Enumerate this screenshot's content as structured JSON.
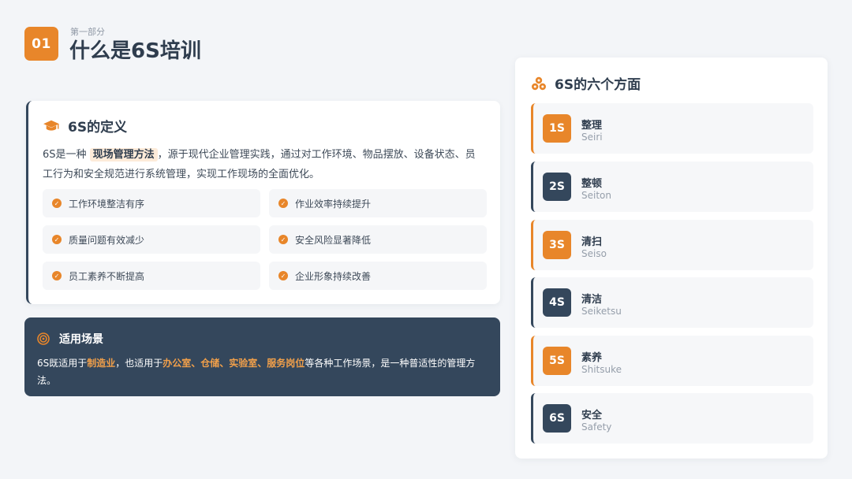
{
  "header": {
    "number": "01",
    "subtitle": "第一部分",
    "title": "什么是6S培训"
  },
  "definition": {
    "title": "6S的定义",
    "text_before": "6S是一种 ",
    "highlight": "现场管理方法",
    "text_after": "，源于现代企业管理实践，通过对工作环境、物品摆放、设备状态、员工行为和安全规范进行系统管理，实现工作现场的全面优化。",
    "features": [
      "工作环境整洁有序",
      "作业效率持续提升",
      "质量问题有效减少",
      "安全风险显著降低",
      "员工素养不断提高",
      "企业形象持续改善"
    ]
  },
  "scenario": {
    "title": "适用场景",
    "text_1": "6S既适用于",
    "h1": "制造业",
    "text_2": "，也适用于",
    "h2": "办公室、仓储、实验室、服务岗位",
    "text_3": "等各种工作场景，是一种普适性的管理方法。"
  },
  "aspects": {
    "title": "6S的六个方面",
    "items": [
      {
        "code": "1S",
        "zh": "整理",
        "en": "Seiri"
      },
      {
        "code": "2S",
        "zh": "整顿",
        "en": "Seiton"
      },
      {
        "code": "3S",
        "zh": "清扫",
        "en": "Seiso"
      },
      {
        "code": "4S",
        "zh": "清洁",
        "en": "Seiketsu"
      },
      {
        "code": "5S",
        "zh": "素养",
        "en": "Shitsuke"
      },
      {
        "code": "6S",
        "zh": "安全",
        "en": "Safety"
      }
    ]
  },
  "colors": {
    "accent": "#e8862a",
    "navy": "#34475c",
    "background": "#f3f5f8"
  }
}
